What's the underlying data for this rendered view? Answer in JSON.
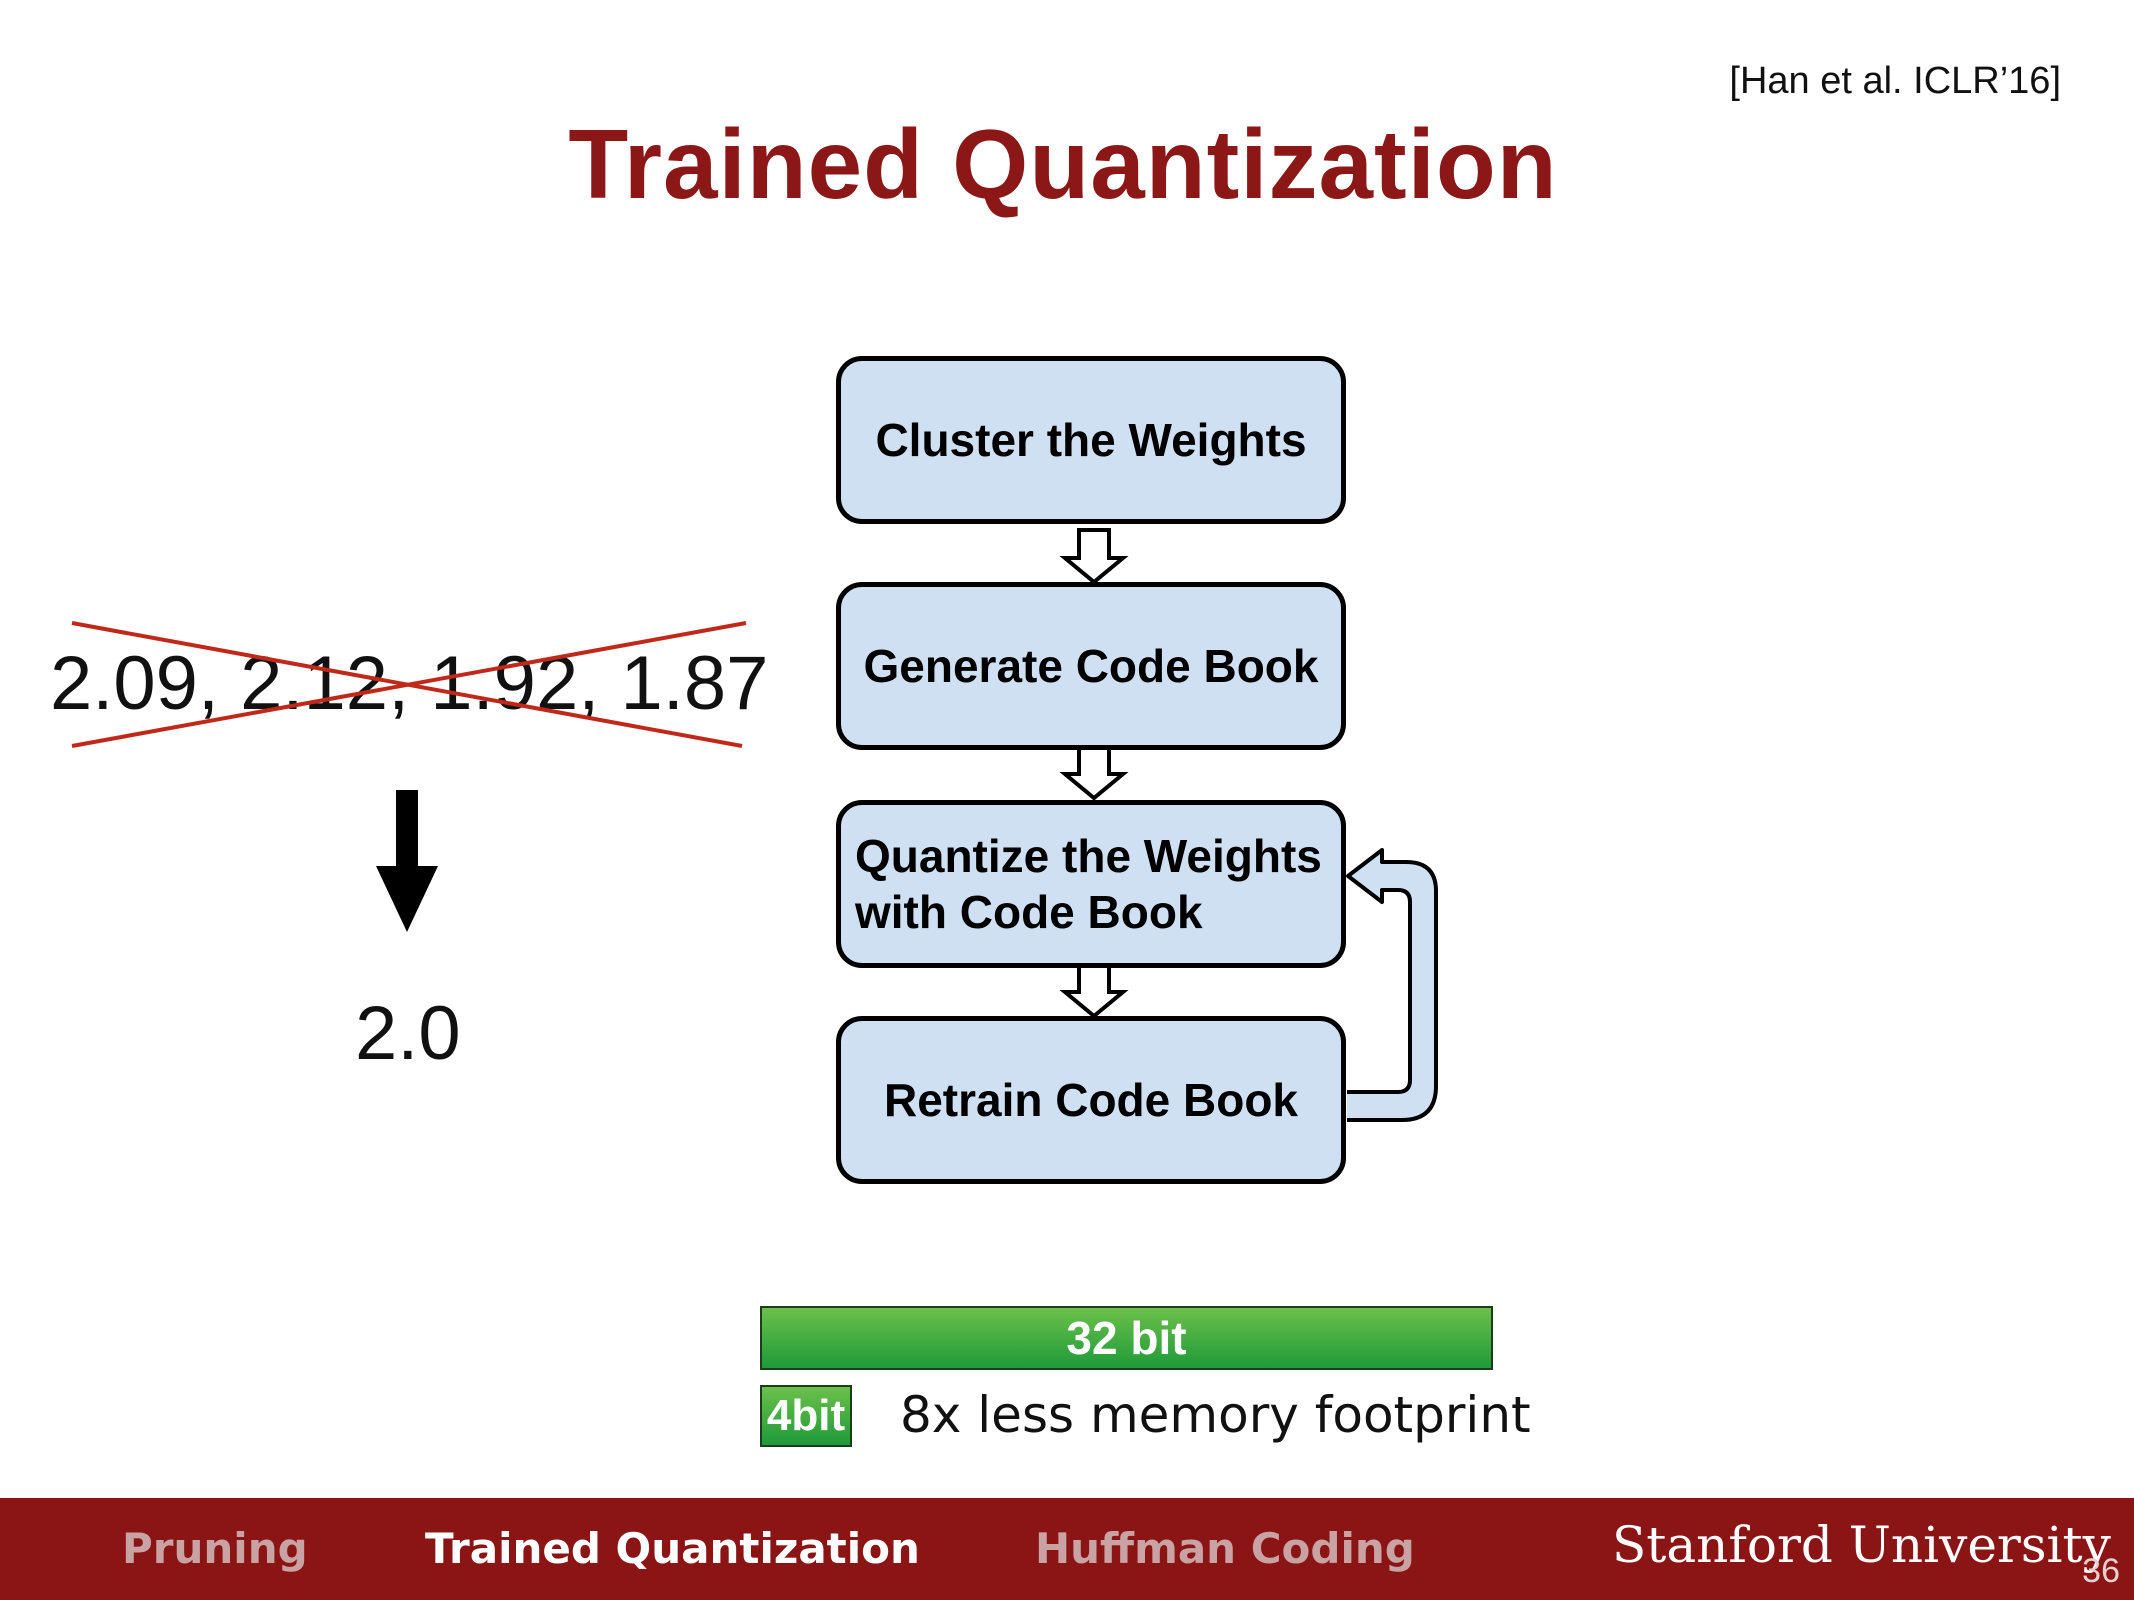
{
  "citation": "[Han et al. ICLR’16]",
  "title": "Trained Quantization",
  "weights": "2.09, 2.12, 1.92, 1.87",
  "result": "2.0",
  "steps": [
    {
      "label": "Cluster the Weights"
    },
    {
      "label": "Generate Code Book"
    },
    {
      "label": "Quantize the Weights with Code Book",
      "line1": "Quantize the Weights",
      "line2": "with Code Book"
    },
    {
      "label": "Retrain Code Book"
    }
  ],
  "bits": {
    "full": "32 bit",
    "quantized": "4bit",
    "note": "8x less memory footprint"
  },
  "footer": {
    "nav": [
      "Pruning",
      "Trained Quantization",
      "Huffman Coding"
    ],
    "active": "Trained Quantization",
    "brand": "Stanford University",
    "page": "36"
  },
  "colors": {
    "accent": "#8b1717",
    "box_fill": "#d0e0f3",
    "cross": "#c0291a",
    "bar_green": "#1f9a3a"
  }
}
